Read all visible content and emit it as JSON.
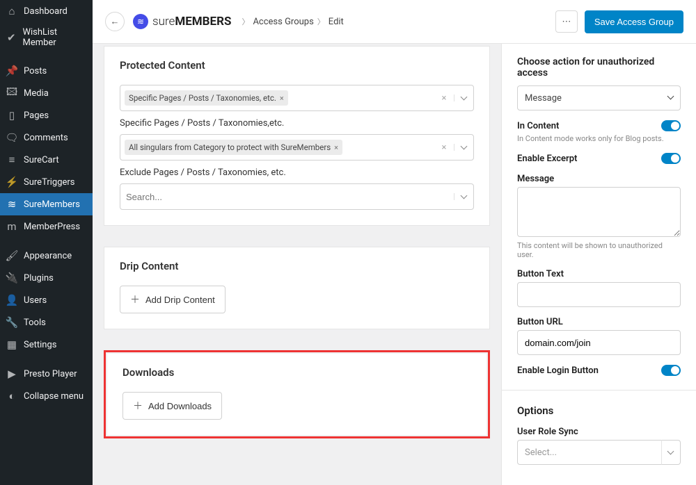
{
  "sidebar": {
    "items": [
      {
        "icon": "⌂",
        "label": "Dashboard"
      },
      {
        "icon": "✔",
        "label": "WishList Member"
      },
      {
        "icon": "📌",
        "label": "Posts"
      },
      {
        "icon": "🖾",
        "label": "Media"
      },
      {
        "icon": "▯",
        "label": "Pages"
      },
      {
        "icon": "🗨",
        "label": "Comments"
      },
      {
        "icon": "≡",
        "label": "SureCart"
      },
      {
        "icon": "⚡",
        "label": "SureTriggers"
      },
      {
        "icon": "≋",
        "label": "SureMembers"
      },
      {
        "icon": "m",
        "label": "MemberPress"
      },
      {
        "icon": "🖌",
        "label": "Appearance"
      },
      {
        "icon": "🔌",
        "label": "Plugins"
      },
      {
        "icon": "👤",
        "label": "Users"
      },
      {
        "icon": "🔧",
        "label": "Tools"
      },
      {
        "icon": "▦",
        "label": "Settings"
      },
      {
        "icon": "▶",
        "label": "Presto Player"
      },
      {
        "icon": "◐",
        "label": "Collapse menu"
      }
    ],
    "active_index": 8
  },
  "topbar": {
    "brand_thin": "sure",
    "brand_bold": "MEMBERS",
    "crumb1": "Access Groups",
    "crumb2": "Edit",
    "save_label": "Save Access Group"
  },
  "main": {
    "protected": {
      "title": "Protected Content",
      "tag1": "Specific Pages / Posts / Taxonomies, etc.",
      "label_specific": "Specific Pages / Posts / Taxonomies,etc.",
      "tag2": "All singulars from Category to protect with SureMembers",
      "label_exclude": "Exclude Pages / Posts / Taxonomies, etc.",
      "search_placeholder": "Search..."
    },
    "drip": {
      "title": "Drip Content",
      "button": "Add Drip Content"
    },
    "downloads": {
      "title": "Downloads",
      "button": "Add Downloads"
    }
  },
  "right": {
    "choose_action": "Choose action for unauthorized access",
    "action_value": "Message",
    "in_content": "In Content",
    "in_content_help": "In Content mode works only for Blog posts.",
    "enable_excerpt": "Enable Excerpt",
    "message_label": "Message",
    "message_help": "This content will be shown to unauthorized user.",
    "button_text_label": "Button Text",
    "button_url_label": "Button URL",
    "button_url_value": "domain.com/join",
    "enable_login": "Enable Login Button",
    "options_title": "Options",
    "user_role_label": "User Role Sync",
    "user_role_placeholder": "Select..."
  }
}
